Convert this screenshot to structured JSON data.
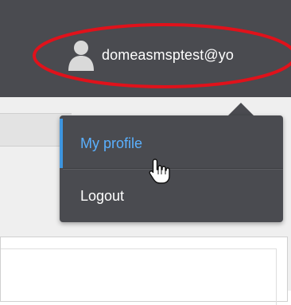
{
  "header": {
    "user_name": "domeasmsptest@yo",
    "user_icon": "user-icon"
  },
  "user_menu": {
    "items": [
      {
        "label": "My profile",
        "active": true
      },
      {
        "label": "Logout",
        "active": false
      }
    ]
  },
  "annotation": {
    "highlight_color": "#e0121b",
    "cursor_icon": "hand-pointer-icon"
  },
  "colors": {
    "topbar": "#4a4b50",
    "menu_background": "#4a4b50",
    "active_accent": "#3d95e0",
    "active_text": "#5ab0ff"
  }
}
